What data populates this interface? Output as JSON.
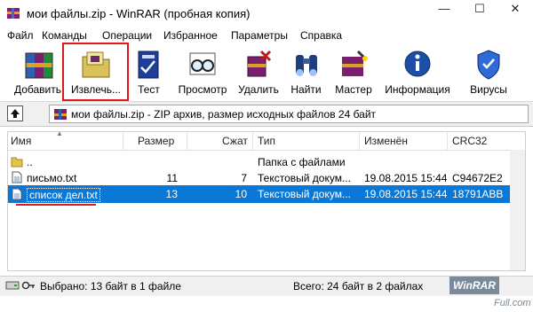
{
  "window": {
    "title": "мои файлы.zip - WinRAR (пробная копия)",
    "minimize_glyph": "—",
    "maximize_glyph": "☐",
    "close_glyph": "✕"
  },
  "menu": [
    "Файл",
    "Команды",
    "Операции",
    "Избранное",
    "Параметры",
    "Справка"
  ],
  "toolbar": [
    {
      "label": "Добавить",
      "icon": "archive-books-icon"
    },
    {
      "label": "Извлечь...",
      "icon": "extract-folder-icon"
    },
    {
      "label": "Тест",
      "icon": "test-book-icon"
    },
    {
      "label": "Просмотр",
      "icon": "view-glasses-icon"
    },
    {
      "label": "Удалить",
      "icon": "delete-icon"
    },
    {
      "label": "Найти",
      "icon": "binoculars-icon"
    },
    {
      "label": "Мастер",
      "icon": "wizard-icon"
    },
    {
      "label": "Информация",
      "icon": "info-icon"
    },
    {
      "label": "Вирусы",
      "icon": "virus-scan-icon"
    }
  ],
  "path_bar": {
    "text": "мои файлы.zip - ZIP архив, размер исходных файлов 24 байт"
  },
  "table": {
    "headers": [
      "Имя",
      "Размер",
      "Сжат",
      "Тип",
      "Изменён",
      "CRC32"
    ],
    "rows": [
      {
        "name": "..",
        "size": "",
        "packed": "",
        "type": "Папка с файлами",
        "modified": "",
        "crc": "",
        "icon": "folder-icon",
        "selected": false
      },
      {
        "name": "письмо.txt",
        "size": "11",
        "packed": "7",
        "type": "Текстовый докум...",
        "modified": "19.08.2015 15:44",
        "crc": "C94672E2",
        "icon": "text-file-icon",
        "selected": false
      },
      {
        "name": "список дел.txt",
        "size": "13",
        "packed": "10",
        "type": "Текстовый докум...",
        "modified": "19.08.2015 15:44",
        "crc": "18791ABB",
        "icon": "text-file-icon",
        "selected": true
      }
    ]
  },
  "status": {
    "left": "Выбрано: 13 байт в 1 файле",
    "right": "Всего: 24 байт в 2 файлах",
    "watermark_brand": "WinRAR",
    "watermark_suffix": "-Full.com"
  },
  "colors": {
    "selection": "#0a78d7",
    "highlight_red": "#e0181e"
  }
}
